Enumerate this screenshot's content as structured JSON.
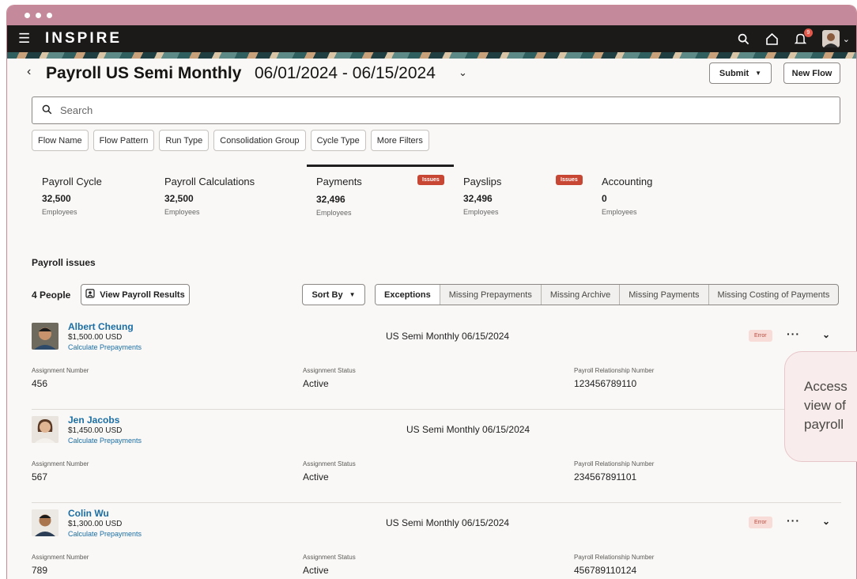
{
  "app": {
    "logo": "INSPIRE",
    "notification_count": "9"
  },
  "header": {
    "title": "Payroll US Semi Monthly",
    "date_range": "06/01/2024 - 06/15/2024",
    "submit_label": "Submit",
    "new_flow_label": "New Flow"
  },
  "search": {
    "placeholder": "Search"
  },
  "filters": [
    "Flow Name",
    "Flow Pattern",
    "Run Type",
    "Consolidation Group",
    "Cycle Type",
    "More Filters"
  ],
  "tiles": [
    {
      "name": "Payroll Cycle",
      "value": "32,500",
      "unit": "Employees",
      "issues": ""
    },
    {
      "name": "Payroll Calculations",
      "value": "32,500",
      "unit": "Employees",
      "issues": ""
    },
    {
      "name": "Payments",
      "value": "32,496",
      "unit": "Employees",
      "issues": "Issues"
    },
    {
      "name": "Payslips",
      "value": "32,496",
      "unit": "Employees",
      "issues": "Issues"
    },
    {
      "name": "Accounting",
      "value": "0",
      "unit": "Employees",
      "issues": ""
    }
  ],
  "issues": {
    "title": "Payroll issues",
    "people_count": "4 People",
    "view_results_label": "View Payroll Results",
    "sort_by_label": "Sort By",
    "segments": [
      "Exceptions",
      "Missing Prepayments",
      "Missing Archive",
      "Missing Payments",
      "Missing Costing of Payments"
    ]
  },
  "field_labels": {
    "assignment_number": "Assignment Number",
    "assignment_status": "Assignment Status",
    "relationship_number": "Payroll Relationship Number"
  },
  "people": [
    {
      "name": "Albert Cheung",
      "amount": "$1,500.00 USD",
      "action": "Calculate Prepayments",
      "cycle": "US Semi Monthly 06/15/2024",
      "status_badge": "Error",
      "assignment_number": "456",
      "assignment_status": "Active",
      "relationship_number": "123456789110"
    },
    {
      "name": "Jen Jacobs",
      "amount": "$1,450.00 USD",
      "action": "Calculate Prepayments",
      "cycle": "US Semi Monthly 06/15/2024",
      "status_badge": "",
      "assignment_number": "567",
      "assignment_status": "Active",
      "relationship_number": "234567891101"
    },
    {
      "name": "Colin Wu",
      "amount": "$1,300.00 USD",
      "action": "Calculate Prepayments",
      "cycle": "US Semi Monthly 06/15/2024",
      "status_badge": "Error",
      "assignment_number": "789",
      "assignment_status": "Active",
      "relationship_number": "456789110124"
    }
  ],
  "callout": {
    "line1": "Access",
    "line2": "view of",
    "line3": "payroll"
  }
}
